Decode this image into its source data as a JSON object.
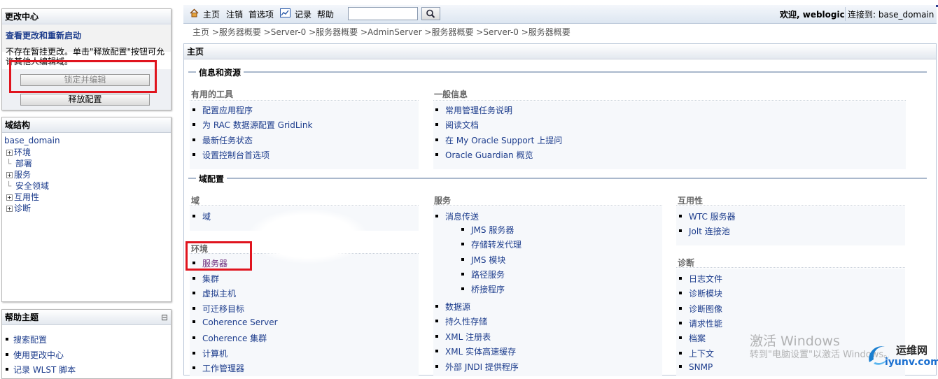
{
  "change_center": {
    "title": "更改中心",
    "link": "查看更改和重新启动",
    "message": "不存在暂挂更改。单击\"释放配置\"按钮可允许其他人编辑域。",
    "lock_button": "锁定并编辑",
    "release_button": "释放配置"
  },
  "domain_structure": {
    "title": "域结构",
    "root": "base_domain",
    "nodes": [
      {
        "label": "环境",
        "expandable": true
      },
      {
        "label": "部署",
        "expandable": false
      },
      {
        "label": "服务",
        "expandable": true
      },
      {
        "label": "安全领域",
        "expandable": false
      },
      {
        "label": "互用性",
        "expandable": true
      },
      {
        "label": "诊断",
        "expandable": true
      }
    ]
  },
  "help_topics": {
    "title": "帮助主题",
    "collapse_glyph": "⊟",
    "items": [
      "搜索配置",
      "使用更改中心",
      "记录 WLST 脚本"
    ]
  },
  "toolbar": {
    "home": "主页",
    "logout": "注销",
    "preferences": "首选项",
    "record": "记录",
    "help": "帮助",
    "search_value": "",
    "welcome": "欢迎, weblogic",
    "connected": "连接到: base_domain"
  },
  "breadcrumb": "主页 >服务器概要 >Server-0 >服务器概要 >AdminServer >服务器概要 >Server-0 >服务器概要",
  "main": {
    "page_title": "主页",
    "info_section": "信息和资源",
    "useful_tools_title": "有用的工具",
    "useful_tools": [
      "配置应用程序",
      "为 RAC 数据源配置 GridLink",
      "最新任务状态",
      "设置控制台首选项"
    ],
    "general_info_title": "一般信息",
    "general_info": [
      "常用管理任务说明",
      "阅读文档",
      "在 My Oracle Support 上提问",
      "Oracle Guardian 概览"
    ],
    "domain_config_section": "域配置",
    "domain_title": "域",
    "domain_items": [
      "域"
    ],
    "env_title": "环境",
    "env_items": [
      "服务器",
      "集群",
      "虚拟主机",
      "可迁移目标",
      "Coherence Server",
      "Coherence 集群",
      "计算机",
      "工作管理器"
    ],
    "services_title": "服务",
    "services_items": [
      "消息传送",
      "数据源",
      "持久性存储",
      "XML 注册表",
      "XML 实体高速缓存",
      "外部 JNDI 提供程序"
    ],
    "messaging_sub": [
      "JMS 服务器",
      "存储转发代理",
      "JMS 模块",
      "路径服务",
      "桥接程序"
    ],
    "interop_title": "互用性",
    "interop_items": [
      "WTC 服务器",
      "Jolt 连接池"
    ],
    "diag_title": "诊断",
    "diag_items": [
      "日志文件",
      "诊断模块",
      "诊断图像",
      "请求性能",
      "档案",
      "上下文",
      "SNMP"
    ]
  },
  "watermark": {
    "line1": "激活 Windows",
    "line2": "转到\"电脑设置\"以激活 Windows。",
    "logo_text": "运维网",
    "logo_url": "iyunv.com"
  },
  "colors": {
    "link": "#1c3c8c",
    "highlight": "#e0141e",
    "section_line": "#aab8cc"
  }
}
